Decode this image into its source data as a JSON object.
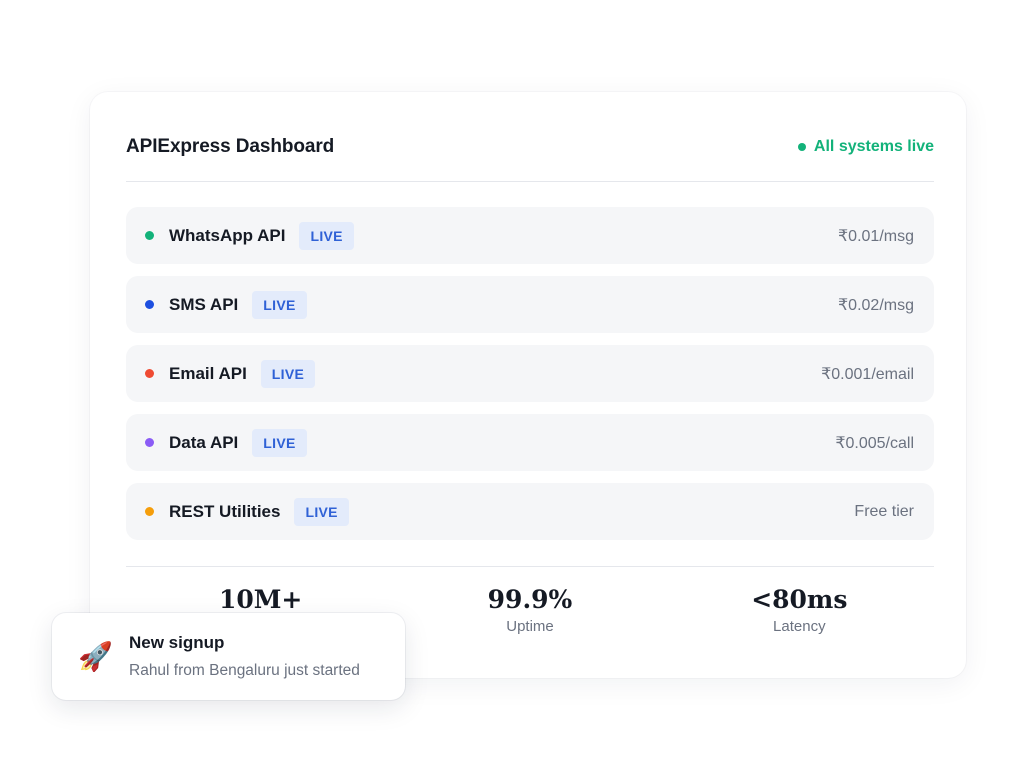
{
  "card": {
    "title": "APIExpress Dashboard",
    "status": {
      "label": "All systems live",
      "color": "#13b27a"
    }
  },
  "apis": [
    {
      "name": "WhatsApp API",
      "badge": "LIVE",
      "price": "₹0.01/msg",
      "dot_color": "#13b27a"
    },
    {
      "name": "SMS API",
      "badge": "LIVE",
      "price": "₹0.02/msg",
      "dot_color": "#1d4fe0"
    },
    {
      "name": "Email API",
      "badge": "LIVE",
      "price": "₹0.001/email",
      "dot_color": "#ef4b33"
    },
    {
      "name": "Data API",
      "badge": "LIVE",
      "price": "₹0.005/call",
      "dot_color": "#8b5cf6"
    },
    {
      "name": "REST Utilities",
      "badge": "LIVE",
      "price": "Free tier",
      "dot_color": "#f59e0b"
    }
  ],
  "stats": [
    {
      "value": "10M+",
      "label": ""
    },
    {
      "value": "99.9%",
      "label": "Uptime"
    },
    {
      "value": "<80ms",
      "label": "Latency"
    }
  ],
  "toast": {
    "icon": "rocket-icon",
    "title": "New signup",
    "body": "Rahul from Bengaluru just started"
  }
}
